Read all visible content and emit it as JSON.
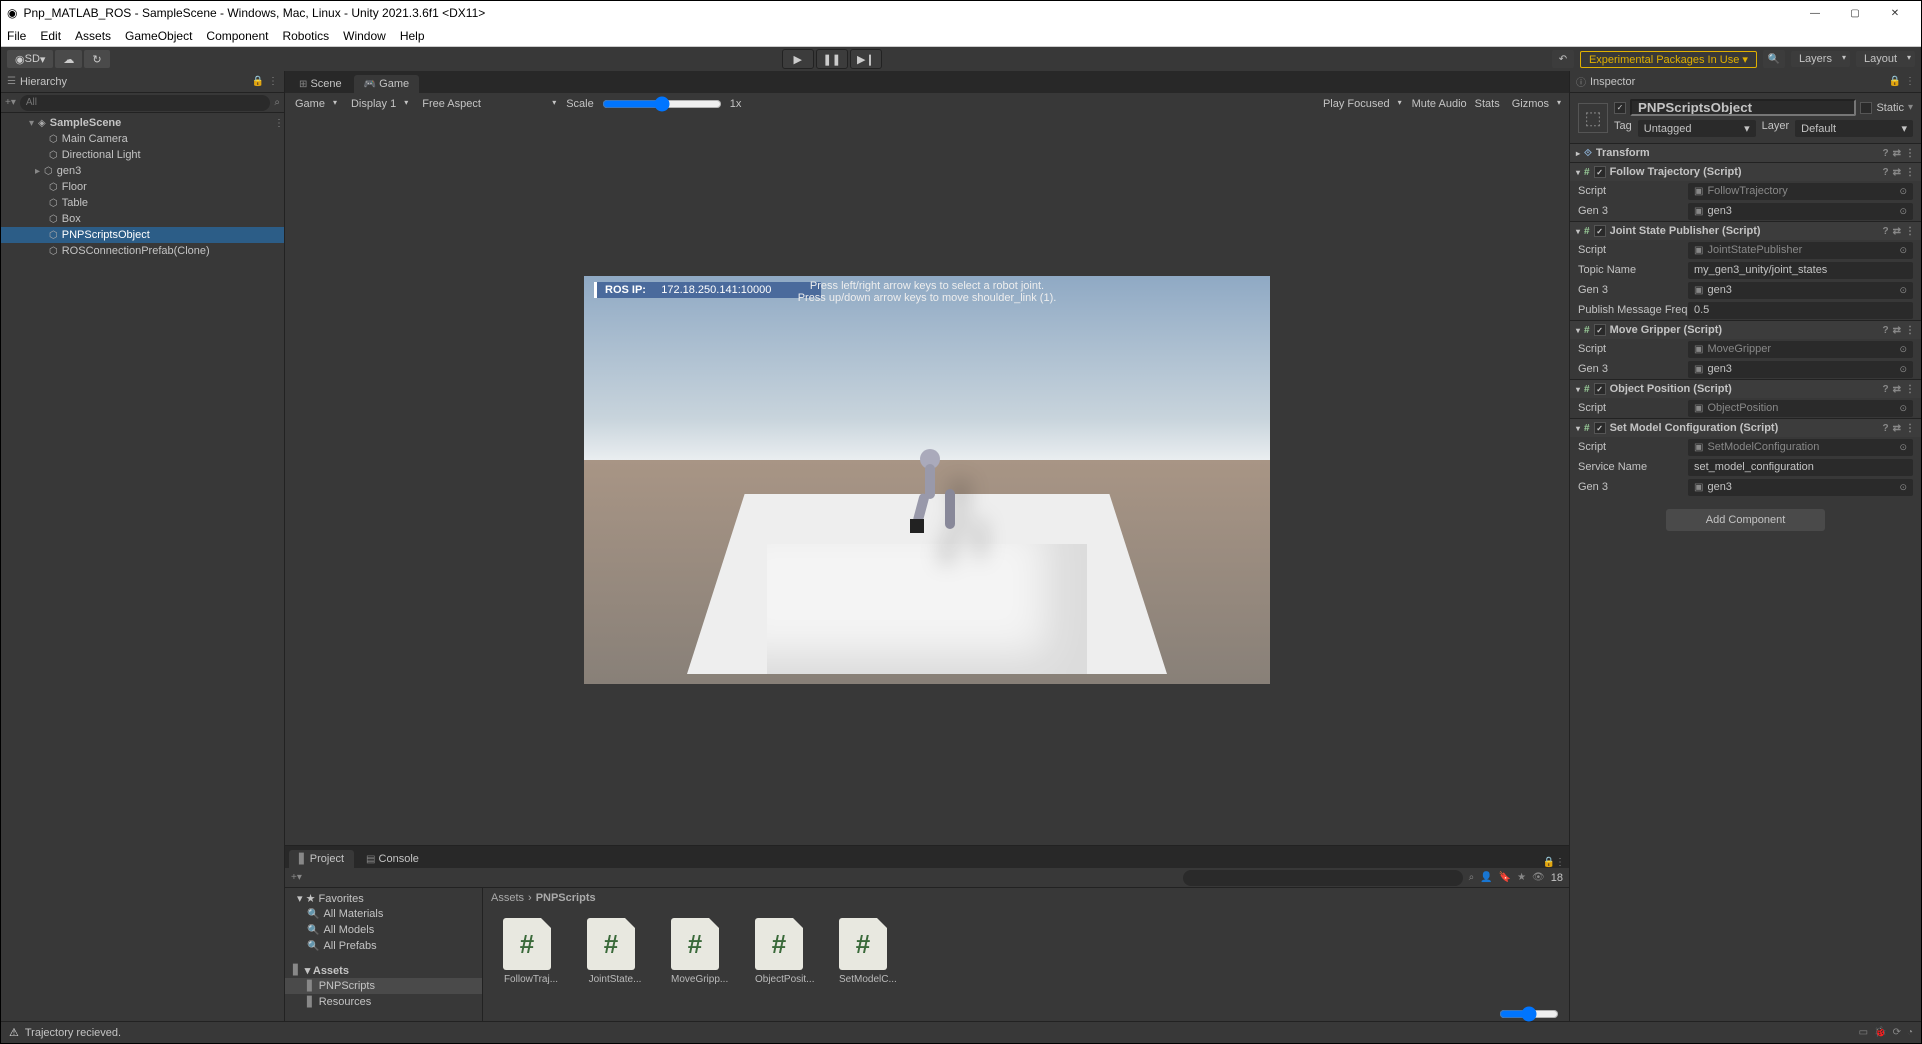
{
  "window": {
    "title": "Pnp_MATLAB_ROS - SampleScene - Windows, Mac, Linux - Unity 2021.3.6f1 <DX11>"
  },
  "menubar": [
    "File",
    "Edit",
    "Assets",
    "GameObject",
    "Component",
    "Robotics",
    "Window",
    "Help"
  ],
  "toolbar": {
    "account": "SD",
    "warning": "Experimental Packages In Use",
    "layers": "Layers",
    "layout": "Layout"
  },
  "hierarchy": {
    "title": "Hierarchy",
    "search_placeholder": "All",
    "scene": "SampleScene",
    "items": [
      "Main Camera",
      "Directional Light",
      "gen3",
      "Floor",
      "Table",
      "Box",
      "PNPScriptsObject",
      "ROSConnectionPrefab(Clone)"
    ],
    "selected_index": 6
  },
  "sceneview": {
    "scene_tab": "Scene",
    "game_tab": "Game",
    "display": "Display 1",
    "aspect": "Free Aspect",
    "camera": "Game",
    "scale_label": "Scale",
    "scale_value": "1x",
    "play_focused": "Play Focused",
    "mute": "Mute Audio",
    "stats": "Stats",
    "gizmos": "Gizmos",
    "ros_ip_label": "ROS IP:",
    "ros_ip": "172.18.250.141:10000",
    "hint1": "Press left/right arrow keys to select a robot joint.",
    "hint2": "Press up/down arrow keys to move shoulder_link (1)."
  },
  "project": {
    "project_tab": "Project",
    "console_tab": "Console",
    "favorites": "Favorites",
    "fav_items": [
      "All Materials",
      "All Models",
      "All Prefabs"
    ],
    "assets": "Assets",
    "asset_folders": [
      "PNPScripts",
      "Resources"
    ],
    "breadcrumb": [
      "Assets",
      "PNPScripts"
    ],
    "files": [
      "FollowTraj...",
      "JointState...",
      "MoveGripp...",
      "ObjectPosit...",
      "SetModelC..."
    ],
    "hidden_count": "18"
  },
  "inspector": {
    "title": "Inspector",
    "object_name": "PNPScriptsObject",
    "static": "Static",
    "tag_label": "Tag",
    "tag": "Untagged",
    "layer_label": "Layer",
    "layer": "Default",
    "transform": "Transform",
    "components": [
      {
        "name": "Follow Trajectory (Script)",
        "fields": [
          {
            "label": "Script",
            "value": "FollowTrajectory",
            "ro": true,
            "obj": true
          },
          {
            "label": "Gen 3",
            "value": "gen3",
            "ro": false,
            "obj": true
          }
        ]
      },
      {
        "name": "Joint State Publisher (Script)",
        "fields": [
          {
            "label": "Script",
            "value": "JointStatePublisher",
            "ro": true,
            "obj": true
          },
          {
            "label": "Topic Name",
            "value": "my_gen3_unity/joint_states",
            "ro": false,
            "obj": false
          },
          {
            "label": "Gen 3",
            "value": "gen3",
            "ro": false,
            "obj": true
          },
          {
            "label": "Publish Message Freq",
            "value": "0.5",
            "ro": false,
            "obj": false
          }
        ]
      },
      {
        "name": "Move Gripper (Script)",
        "fields": [
          {
            "label": "Script",
            "value": "MoveGripper",
            "ro": true,
            "obj": true
          },
          {
            "label": "Gen 3",
            "value": "gen3",
            "ro": false,
            "obj": true
          }
        ]
      },
      {
        "name": "Object Position (Script)",
        "fields": [
          {
            "label": "Script",
            "value": "ObjectPosition",
            "ro": true,
            "obj": true
          }
        ]
      },
      {
        "name": "Set Model Configuration (Script)",
        "fields": [
          {
            "label": "Script",
            "value": "SetModelConfiguration",
            "ro": true,
            "obj": true
          },
          {
            "label": "Service Name",
            "value": "set_model_configuration",
            "ro": false,
            "obj": false
          },
          {
            "label": "Gen 3",
            "value": "gen3",
            "ro": false,
            "obj": true
          }
        ]
      }
    ],
    "add_component": "Add Component"
  },
  "statusbar": {
    "message": "Trajectory recieved."
  }
}
